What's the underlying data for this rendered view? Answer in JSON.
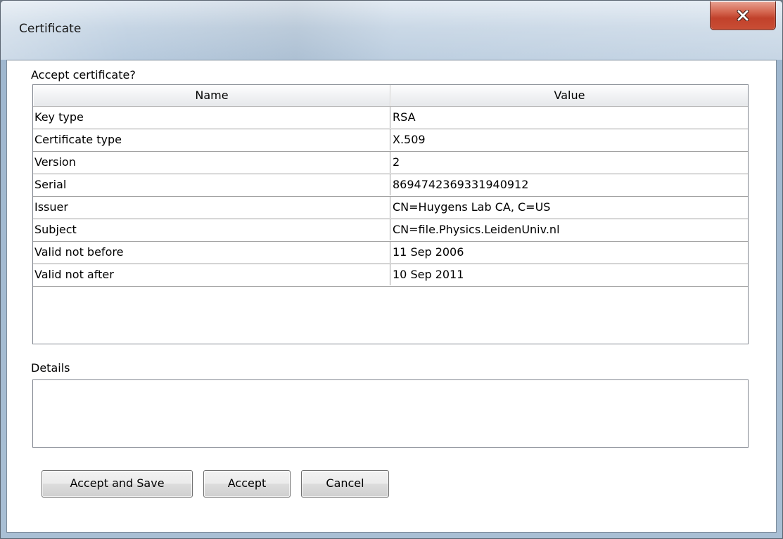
{
  "window": {
    "title": "Certificate"
  },
  "dialog": {
    "prompt": "Accept certificate?",
    "details_label": "Details",
    "details_text": ""
  },
  "table": {
    "columns": [
      "Name",
      "Value"
    ],
    "rows": [
      {
        "name": "Key type",
        "value": "RSA"
      },
      {
        "name": "Certificate type",
        "value": "X.509"
      },
      {
        "name": "Version",
        "value": "2"
      },
      {
        "name": "Serial",
        "value": "8694742369331940912"
      },
      {
        "name": "Issuer",
        "value": "CN=Huygens Lab CA, C=US"
      },
      {
        "name": "Subject",
        "value": "CN=file.Physics.LeidenUniv.nl"
      },
      {
        "name": "Valid not before",
        "value": "11 Sep 2006"
      },
      {
        "name": "Valid not after",
        "value": "10 Sep 2011"
      }
    ]
  },
  "buttons": {
    "accept_and_save": "Accept and Save",
    "accept": "Accept",
    "cancel": "Cancel"
  },
  "icons": {
    "close": "close-icon"
  }
}
